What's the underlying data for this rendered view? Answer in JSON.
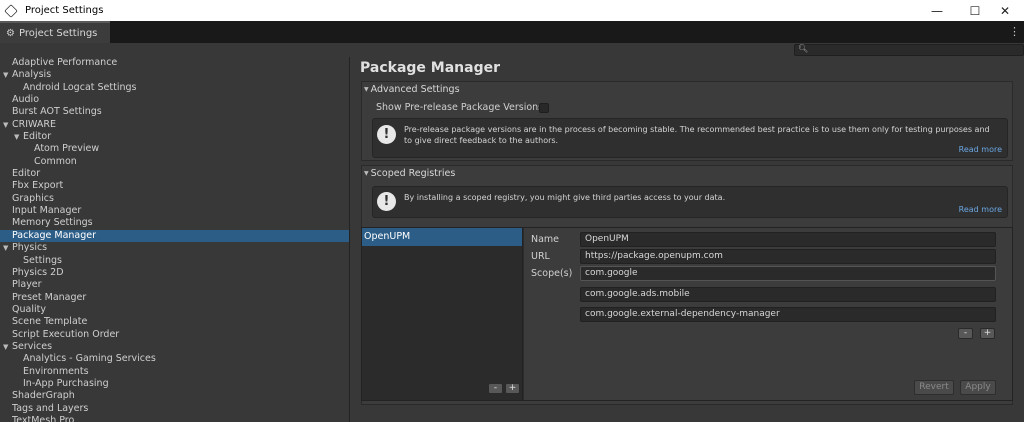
{
  "window": {
    "title": "Project Settings",
    "controls": {
      "minimize": "—",
      "maximize": "☐",
      "close": "✕"
    }
  },
  "tab": {
    "label": "Project Settings",
    "icon": "gear-icon"
  },
  "sidebar": {
    "items": [
      {
        "label": "Adaptive Performance",
        "indent": 0
      },
      {
        "label": "Analysis",
        "indent": 0,
        "expanded": true
      },
      {
        "label": "Android Logcat Settings",
        "indent": 1
      },
      {
        "label": "Audio",
        "indent": 0
      },
      {
        "label": "Burst AOT Settings",
        "indent": 0
      },
      {
        "label": "CRIWARE",
        "indent": 0,
        "expanded": true
      },
      {
        "label": "Editor",
        "indent": 1,
        "expanded": true
      },
      {
        "label": "Atom Preview",
        "indent": 2
      },
      {
        "label": "Common",
        "indent": 2
      },
      {
        "label": "Editor",
        "indent": 0
      },
      {
        "label": "Fbx Export",
        "indent": 0
      },
      {
        "label": "Graphics",
        "indent": 0
      },
      {
        "label": "Input Manager",
        "indent": 0
      },
      {
        "label": "Memory Settings",
        "indent": 0
      },
      {
        "label": "Package Manager",
        "indent": 0,
        "selected": true
      },
      {
        "label": "Physics",
        "indent": 0,
        "expanded": true
      },
      {
        "label": "Settings",
        "indent": 1
      },
      {
        "label": "Physics 2D",
        "indent": 0
      },
      {
        "label": "Player",
        "indent": 0
      },
      {
        "label": "Preset Manager",
        "indent": 0
      },
      {
        "label": "Quality",
        "indent": 0
      },
      {
        "label": "Scene Template",
        "indent": 0
      },
      {
        "label": "Script Execution Order",
        "indent": 0
      },
      {
        "label": "Services",
        "indent": 0,
        "expanded": true
      },
      {
        "label": "Analytics - Gaming Services",
        "indent": 1
      },
      {
        "label": "Environments",
        "indent": 1
      },
      {
        "label": "In-App Purchasing",
        "indent": 1
      },
      {
        "label": "ShaderGraph",
        "indent": 0
      },
      {
        "label": "Tags and Layers",
        "indent": 0
      },
      {
        "label": "TextMesh Pro",
        "indent": 0
      }
    ]
  },
  "main": {
    "title": "Package Manager",
    "advanced": {
      "header": "Advanced Settings",
      "prerelease_label": "Show Pre-release Package Versions",
      "prerelease_checked": false,
      "help_text": "Pre-release package versions are in the process of becoming stable. The recommended best practice is to use them only for testing purposes and to give direct feedback to the authors.",
      "read_more": "Read more"
    },
    "scoped": {
      "header": "Scoped Registries",
      "help_text": "By installing a scoped registry, you might give third parties access to your data.",
      "read_more": "Read more",
      "registries": [
        "OpenUPM"
      ],
      "labels": {
        "name": "Name",
        "url": "URL",
        "scopes": "Scope(s)"
      },
      "name_value": "OpenUPM",
      "url_value": "https://package.openupm.com",
      "scopes": [
        "com.google",
        "com.google.ads.mobile",
        "com.google.external-dependency-manager"
      ],
      "minus": "-",
      "plus": "+",
      "revert": "Revert",
      "apply": "Apply"
    }
  },
  "colors": {
    "selection": "#2c5d87",
    "link": "#6aa6e3",
    "background": "#383838"
  }
}
